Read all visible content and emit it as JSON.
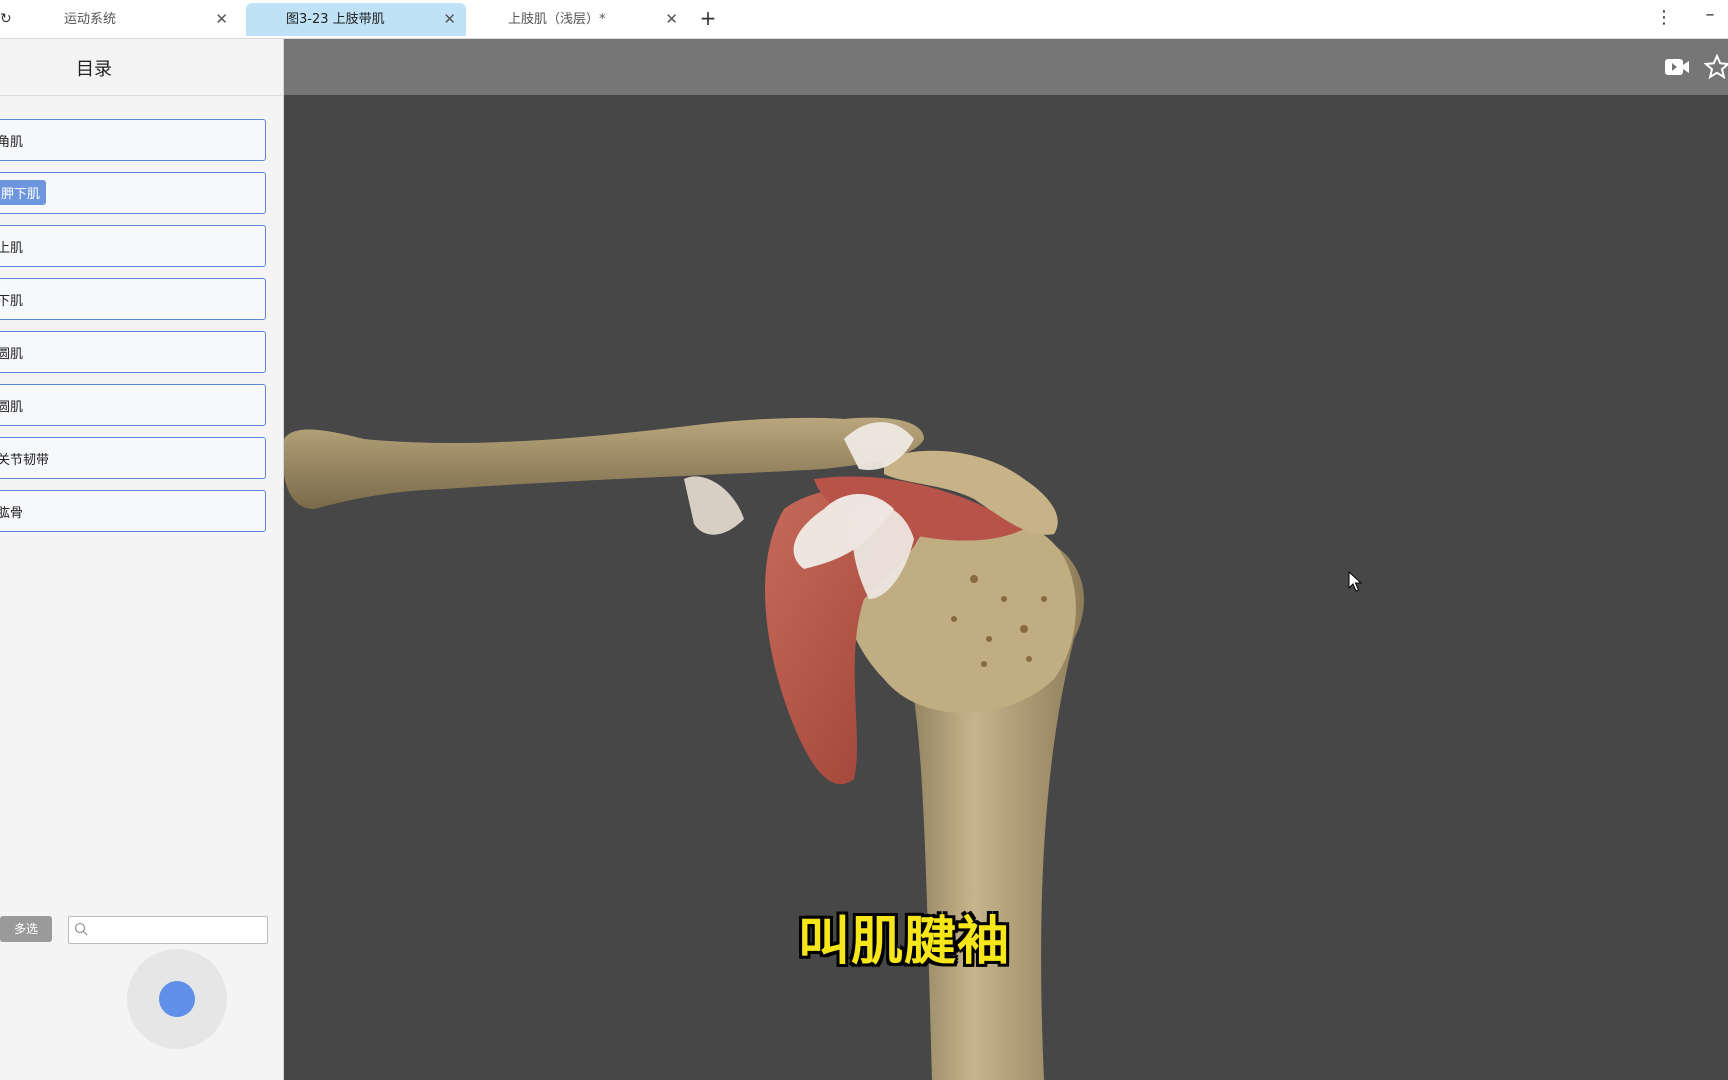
{
  "tabs": [
    {
      "label": "运动系统",
      "active": false
    },
    {
      "label": "图3-23 上肢带肌",
      "active": true
    },
    {
      "label": "上肢肌（浅层）*",
      "active": false
    }
  ],
  "sidebar": {
    "title": "目录",
    "items": [
      {
        "label": "角肌"
      },
      {
        "label": "胛下肌",
        "selected": true
      },
      {
        "label": "上肌"
      },
      {
        "label": "下肌"
      },
      {
        "label": "圆肌"
      },
      {
        "label": "圆肌"
      },
      {
        "label": "关节韧带"
      },
      {
        "label": "肱骨"
      }
    ],
    "multi_select_label": "多选",
    "search_placeholder": ""
  },
  "viewer": {
    "subtitle": "叫肌腱袖"
  },
  "colors": {
    "accent": "#5c87d6",
    "selected_fill": "#6e96de",
    "viewer_bg": "#474747",
    "toolbar_bg": "#767676",
    "subtitle": "#f6e61a"
  },
  "icons": [
    "refresh-icon",
    "close-icon",
    "add-tab-icon",
    "more-icon",
    "minimize-icon",
    "search-icon",
    "video-icon",
    "star-icon",
    "cursor-icon"
  ]
}
